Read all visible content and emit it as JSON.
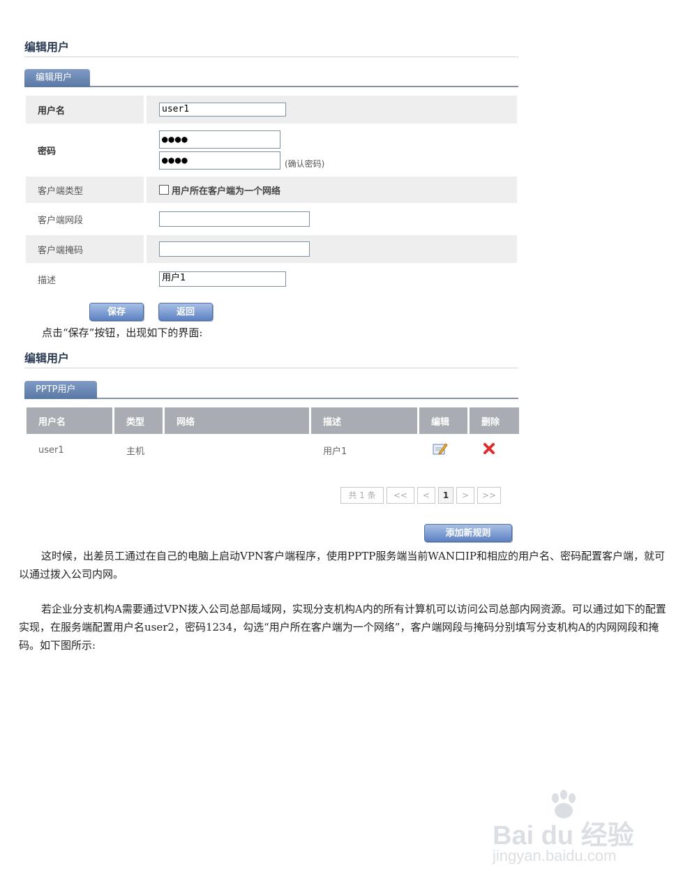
{
  "screen1": {
    "section_title": "编辑用户",
    "tab_label": "编辑用户",
    "fields": {
      "username": {
        "label": "用户名",
        "value": "user1"
      },
      "password": {
        "label": "密码",
        "value": "●●●●",
        "confirm_value": "●●●●",
        "confirm_hint": "(确认密码)"
      },
      "client_type": {
        "label": "客户端类型",
        "checkbox_label": "用户所在客户端为一个网络"
      },
      "client_segment": {
        "label": "客户端网段",
        "value": ""
      },
      "client_mask": {
        "label": "客户端掩码",
        "value": ""
      },
      "description": {
        "label": "描述",
        "value": "用户1"
      }
    },
    "buttons": {
      "save": "保存",
      "back": "返回"
    }
  },
  "caption1": "点击“保存”按钮，出现如下的界面:",
  "screen2": {
    "section_title": "编辑用户",
    "tab_label": "PPTP用户",
    "columns": [
      "用户名",
      "类型",
      "网络",
      "描述",
      "编辑",
      "删除"
    ],
    "rows": [
      {
        "username": "user1",
        "type": "主机",
        "network": "",
        "description": "用户1"
      }
    ],
    "pager": {
      "total": "共 1 条",
      "first": "<<",
      "prev": "<",
      "page": "1",
      "next": ">",
      "last": ">>"
    },
    "add_button": "添加新规则"
  },
  "paragraph1": "这时候，出差员工通过在自己的电脑上启动VPN客户端程序，使用PPTP服务端当前WAN口IP和相应的用户名、密码配置客户端，就可以通过拨入公司内网。",
  "paragraph2": "若企业分支机构A需要通过VPN拨入公司总部局域网，实现分支机构A内的所有计算机可以访问公司总部内网资源。可以通过如下的配置实现，在服务端配置用户名user2，密码1234，勾选“用户所在客户端为一个网络”，客户端网段与掩码分别填写分支机构A的内网网段和掩码。如下图所示:",
  "watermark": {
    "brand": "Bai du 经验",
    "url": "jingyan.baidu.com"
  },
  "colors": {
    "tab": "#6a86b3",
    "header_gray": "#a9adb3",
    "button_blue": "#6f91cc",
    "delete_red": "#e02b2b"
  }
}
